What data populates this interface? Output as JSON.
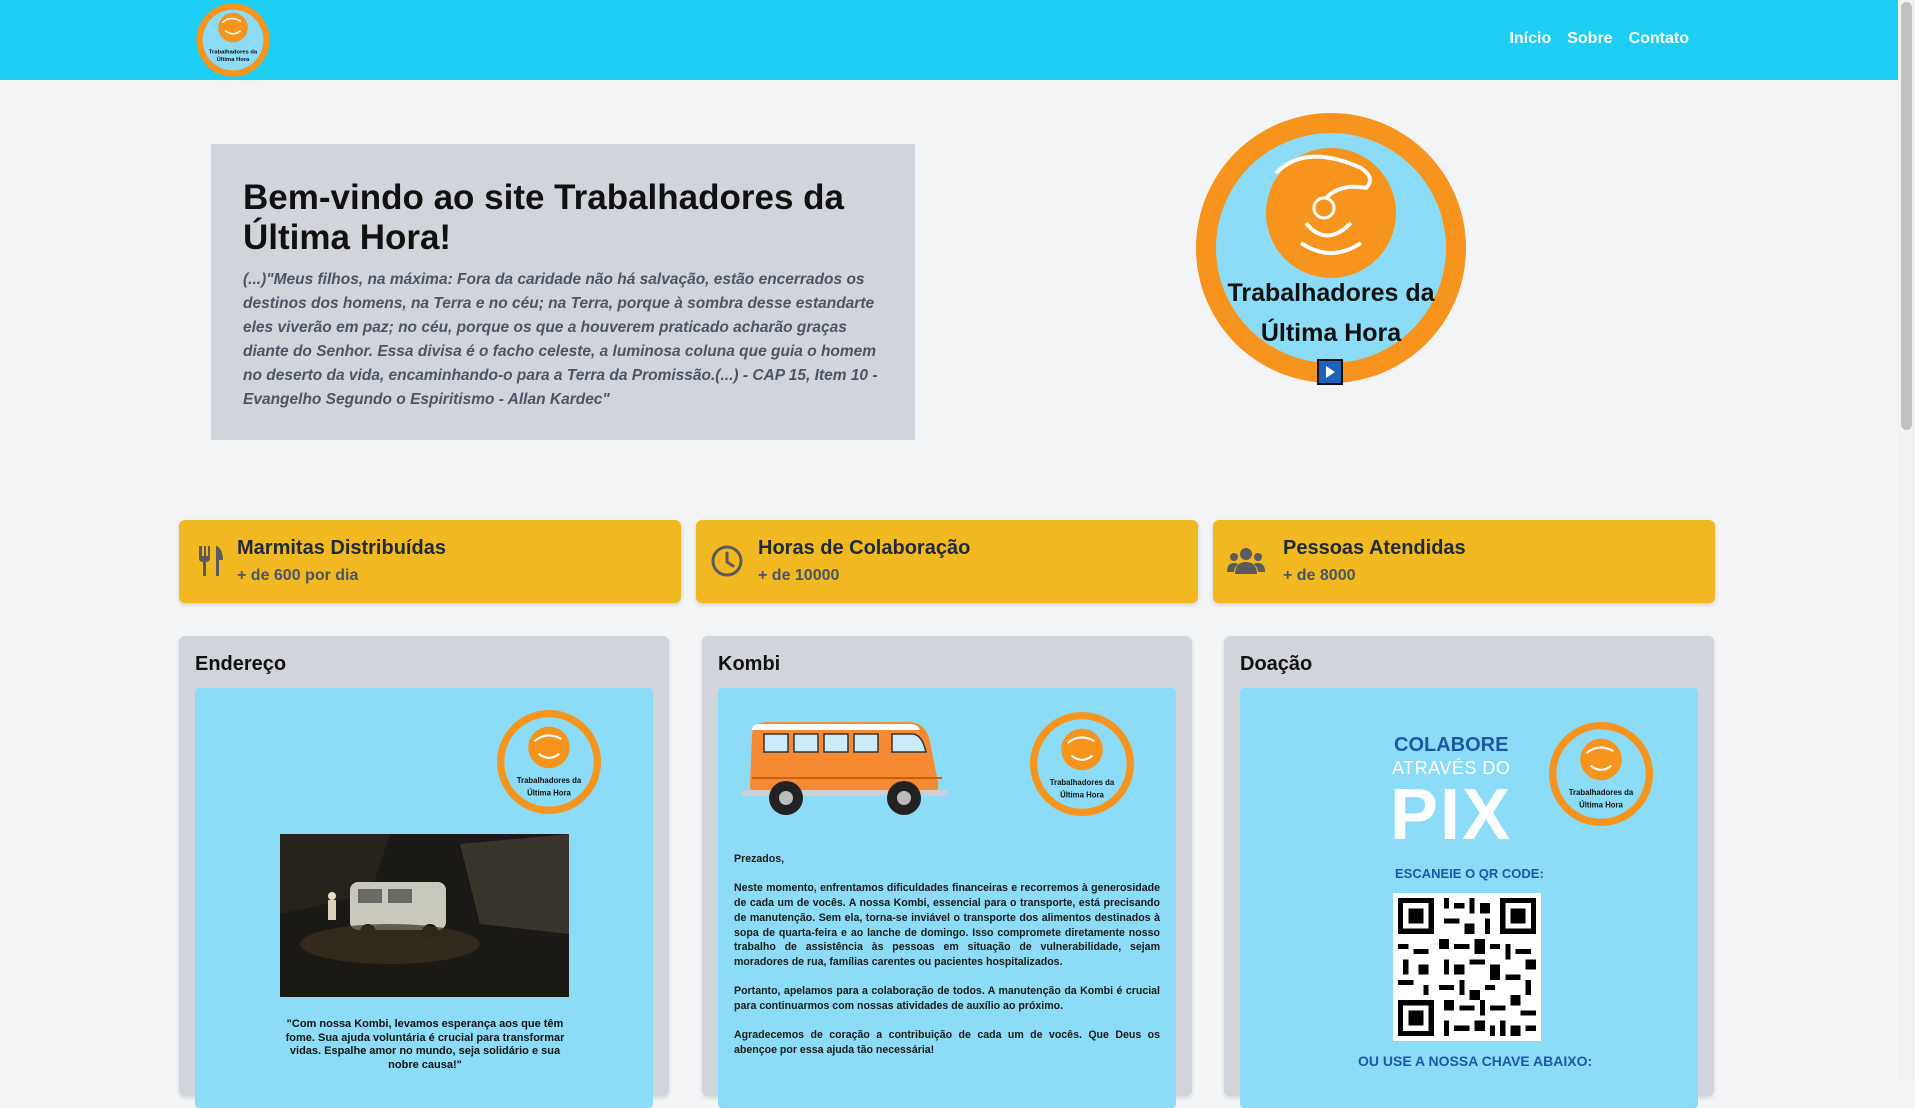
{
  "header": {
    "logo_text_line1": "Trabalhadores da",
    "logo_text_line2": "Última Hora",
    "nav": [
      "Início",
      "Sobre",
      "Contato"
    ]
  },
  "hero": {
    "title": "Bem-vindo ao site Trabalhadores da Última Hora!",
    "quote": "(...)\"Meus filhos, na máxima: Fora da caridade não há salvação, estão encerrados os destinos dos homens, na Terra e no céu; na Terra, porque à sombra desse estandarte eles viverão em paz; no céu, porque os que a houverem praticado acharão graças diante do Senhor. Essa divisa é o facho celeste, a luminosa coluna que guia o homem no deserto da vida, encaminhando-o para a Terra da Promissão.(...) - CAP 15, Item 10 - Evangelho Segundo o Espiritismo - Allan Kardec\""
  },
  "stats": [
    {
      "icon": "utensils-icon",
      "title": "Marmitas Distribuídas",
      "sub": "+ de 600 por dia"
    },
    {
      "icon": "clock-icon",
      "title": "Horas de Colaboração",
      "sub": "+ de 10000"
    },
    {
      "icon": "users-icon",
      "title": "Pessoas Atendidas",
      "sub": "+ de 8000"
    }
  ],
  "cards": {
    "address": {
      "title": "Endereço",
      "quote": "\"Com nossa Kombi, levamos esperança aos que têm fome. Sua ajuda voluntária é crucial para transformar vidas. Espalhe amor no mundo, seja solidário e sua nobre causa!\""
    },
    "kombi": {
      "title": "Kombi",
      "greeting": "Prezados,",
      "p1": "Neste momento, enfrentamos dificuldades financeiras e recorremos à generosidade de cada um de vocês. A nossa Kombi, essencial para o transporte, está precisando de manutenção. Sem ela, torna-se inviável o transporte dos alimentos destinados à sopa de quarta-feira e ao lanche de domingo. Isso compromete diretamente nosso trabalho de assistência às pessoas em situação de vulnerabilidade, sejam moradores de rua, famílias carentes ou pacientes hospitalizados.",
      "p2": "Portanto, apelamos para a colaboração de todos. A manutenção da Kombi é crucial para continuarmos com nossas atividades de auxílio ao próximo.",
      "p3": "Agradecemos de coração a contribuição de cada um de vocês. Que Deus os abençoe por essa ajuda tão necessária!"
    },
    "donation": {
      "title": "Doação",
      "colabore": "COLABORE",
      "atraves": "ATRAVÉS DO",
      "pix": "PIX",
      "scan": "ESCANEIE O QR CODE:",
      "key": "OU USE A NOSSA CHAVE ABAIXO:"
    }
  },
  "colors": {
    "header_bg": "#1ecff5",
    "stat_bg": "#f2b822",
    "logo_orange": "#f7941d",
    "logo_light_blue": "#8cdcf7",
    "pix_blue": "#1e57a8"
  }
}
